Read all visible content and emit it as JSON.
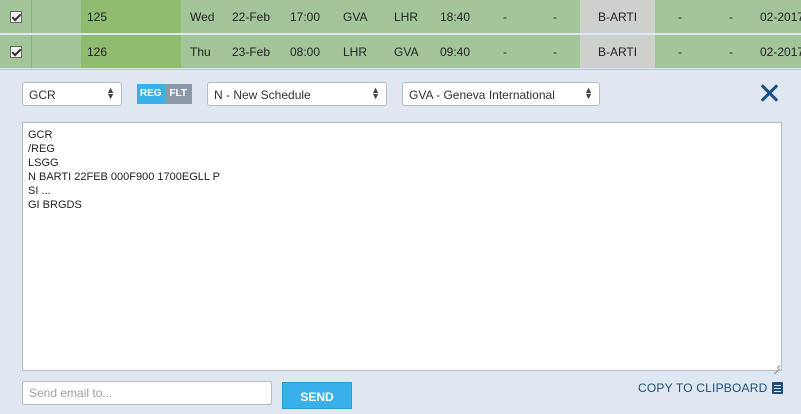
{
  "rows": [
    {
      "num": "125",
      "day": "Wed",
      "date": "22-Feb",
      "time1": "17:00",
      "from": "GVA",
      "to": "LHR",
      "time2": "18:40",
      "d1": "-",
      "d2": "-",
      "reg": "B-ARTI",
      "d3": "-",
      "d4": "-",
      "tail": "02-2017"
    },
    {
      "num": "126",
      "day": "Thu",
      "date": "23-Feb",
      "time1": "08:00",
      "from": "LHR",
      "to": "GVA",
      "time2": "09:40",
      "d1": "-",
      "d2": "-",
      "reg": "B-ARTI",
      "d3": "-",
      "d4": "-",
      "tail": "02-2017"
    }
  ],
  "panel": {
    "message_type": "GCR",
    "toggle": {
      "reg": "REG",
      "flt": "FLT",
      "active": "REG"
    },
    "action": "N - New Schedule",
    "airport": "GVA - Geneva International",
    "message": "GCR\n/REG\nLSGG\nN BARTI 22FEB 000F900 1700EGLL P\nSI ...\nGI BRGDS",
    "email_placeholder": "Send email to...",
    "send_label": "SEND",
    "copy_label": "COPY TO CLIPBOARD"
  },
  "colors": {
    "row_green": "#a3c59a",
    "num_green": "#8fbc6f",
    "accent_blue": "#3bb0e6",
    "dark_blue": "#1b4f86"
  },
  "icons": {
    "close": "close-icon",
    "clipboard": "clipboard-icon",
    "checkbox": "checkbox-checked-icon"
  }
}
